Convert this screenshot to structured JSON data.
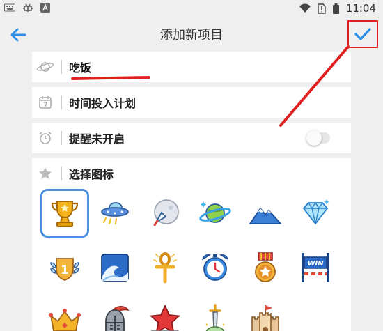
{
  "status_bar": {
    "time": "11:04"
  },
  "header": {
    "title": "添加新项目"
  },
  "name_field": {
    "value": "吃饭"
  },
  "time_plan": {
    "label": "时间投入计划"
  },
  "reminder": {
    "label": "提醒未开启",
    "enabled": false
  },
  "icon_picker": {
    "label": "选择图标",
    "selected_index": 0,
    "icons": [
      "trophy-icon",
      "ufo-icon",
      "rocket-moon-icon",
      "planet-icon",
      "mountain-icon",
      "diamond-icon",
      "medal-one-icon",
      "wave-icon",
      "ankh-icon",
      "alarm-clock-icon",
      "star-medal-icon",
      "win-banner-icon",
      "crown-icon",
      "knight-helmet-icon",
      "red-star-icon",
      "sword-stone-icon",
      "castle-icon"
    ],
    "win_text": "WIN",
    "medal_number": "1"
  },
  "colors": {
    "accent": "#2d8ee6",
    "annotation": "#e02020"
  }
}
